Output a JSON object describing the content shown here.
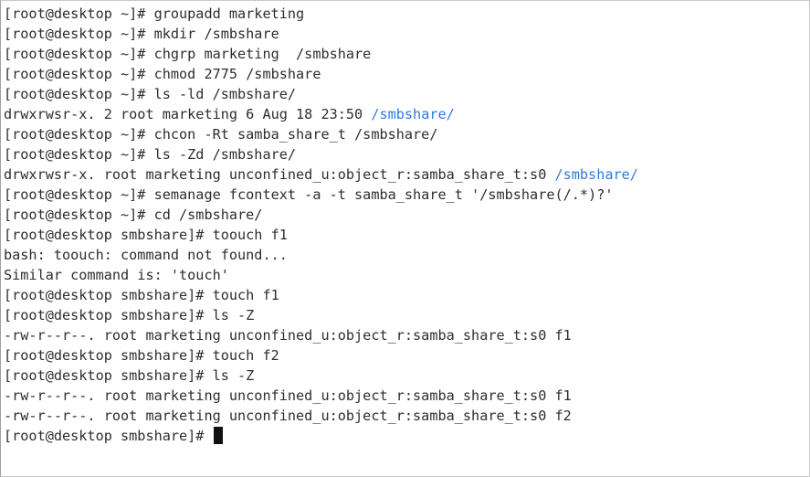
{
  "terminal": {
    "colors": {
      "background": "#ffffff",
      "text": "#2e2e2e",
      "directory": "#2a7be0",
      "cursor": "#111111"
    },
    "lines": [
      {
        "text": "[root@desktop ~]# groupadd marketing",
        "kind": "prompt"
      },
      {
        "text": "[root@desktop ~]# mkdir /smbshare",
        "kind": "prompt"
      },
      {
        "text": "[root@desktop ~]# chgrp marketing  /smbshare",
        "kind": "prompt"
      },
      {
        "text": "[root@desktop ~]# chmod 2775 /smbshare",
        "kind": "prompt"
      },
      {
        "text": "[root@desktop ~]# ls -ld /smbshare/",
        "kind": "prompt"
      },
      {
        "text": "drwxrwsr-x. 2 root marketing 6 Aug 18 23:50 ",
        "dir": "/smbshare/",
        "kind": "output"
      },
      {
        "text": "[root@desktop ~]# chcon -Rt samba_share_t /smbshare/",
        "kind": "prompt"
      },
      {
        "text": "[root@desktop ~]# ls -Zd /smbshare/",
        "kind": "prompt"
      },
      {
        "text": "drwxrwsr-x. root marketing unconfined_u:object_r:samba_share_t:s0 ",
        "dir": "/smbshare/",
        "kind": "output"
      },
      {
        "text": "[root@desktop ~]# semanage fcontext -a -t samba_share_t '/smbshare(/.*)?'",
        "kind": "prompt"
      },
      {
        "text": "[root@desktop ~]# cd /smbshare/",
        "kind": "prompt"
      },
      {
        "text": "[root@desktop smbshare]# toouch f1",
        "kind": "prompt"
      },
      {
        "text": "bash: toouch: command not found...",
        "kind": "output"
      },
      {
        "text": "Similar command is: 'touch'",
        "kind": "output"
      },
      {
        "text": "[root@desktop smbshare]# touch f1",
        "kind": "prompt"
      },
      {
        "text": "[root@desktop smbshare]# ls -Z",
        "kind": "prompt"
      },
      {
        "text": "-rw-r--r--. root marketing unconfined_u:object_r:samba_share_t:s0 f1",
        "kind": "output"
      },
      {
        "text": "[root@desktop smbshare]# touch f2",
        "kind": "prompt"
      },
      {
        "text": "[root@desktop smbshare]# ls -Z",
        "kind": "prompt"
      },
      {
        "text": "-rw-r--r--. root marketing unconfined_u:object_r:samba_share_t:s0 f1",
        "kind": "output"
      },
      {
        "text": "-rw-r--r--. root marketing unconfined_u:object_r:samba_share_t:s0 f2",
        "kind": "output"
      },
      {
        "text": "[root@desktop smbshare]# ",
        "kind": "prompt",
        "cursor": true
      }
    ]
  }
}
